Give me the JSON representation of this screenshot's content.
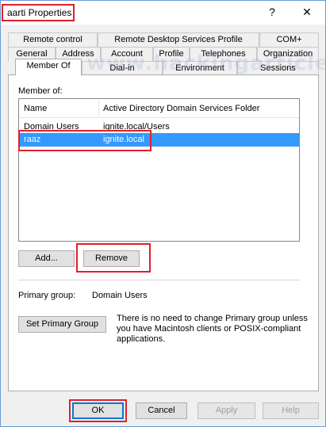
{
  "window": {
    "title": "aarti Properties",
    "help_glyph": "?",
    "close_glyph": "✕"
  },
  "tabs": {
    "row1": [
      "Remote control",
      "Remote Desktop Services Profile",
      "COM+"
    ],
    "row2": [
      "General",
      "Address",
      "Account",
      "Profile",
      "Telephones",
      "Organization"
    ],
    "row3": [
      "Member Of",
      "Dial-in",
      "Environment",
      "Sessions"
    ],
    "active": "Member Of"
  },
  "watermark": "www.hackingarticles.in",
  "member_of": {
    "label": "Member of:",
    "columns": [
      "Name",
      "Active Directory Domain Services Folder"
    ],
    "rows": [
      {
        "name": "Domain Users",
        "folder": "ignite.local/Users",
        "selected": false
      },
      {
        "name": "raaz",
        "folder": "ignite.local",
        "selected": true
      }
    ]
  },
  "buttons": {
    "add": "Add...",
    "remove": "Remove",
    "set_primary": "Set Primary Group",
    "ok": "OK",
    "cancel": "Cancel",
    "apply": "Apply",
    "help": "Help"
  },
  "primary_group": {
    "label": "Primary group:",
    "value": "Domain Users",
    "note_line1": "There is no need to change Primary group unless",
    "note_line2": "you have Macintosh clients or POSIX-compliant",
    "note_line3": "applications."
  },
  "colors": {
    "selection": "#3399ff",
    "highlight_box": "#e0202a"
  }
}
